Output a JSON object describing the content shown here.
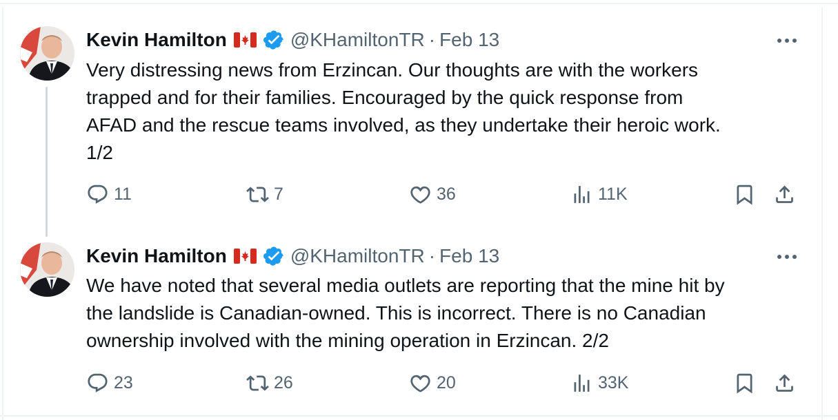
{
  "tweets": [
    {
      "author_name": "Kevin Hamilton",
      "handle": "@KHamiltonTR",
      "separator": "·",
      "date": "Feb 13",
      "text": "Very distressing news from Erzincan. Our thoughts are with the workers\ntrapped and for their families. Encouraged by the quick response from\nAFAD and the rescue teams involved, as they undertake their heroic work.\n1/2",
      "replies": "11",
      "reposts": "7",
      "likes": "36",
      "views": "11K"
    },
    {
      "author_name": "Kevin Hamilton",
      "handle": "@KHamiltonTR",
      "separator": "·",
      "date": "Feb 13",
      "text": "We have noted that several media outlets are reporting that the mine hit by\nthe landslide is Canadian-owned. This is incorrect. There is no Canadian\nownership involved with the mining operation in Erzincan. 2/2",
      "replies": "23",
      "reposts": "26",
      "likes": "20",
      "views": "33K"
    }
  ],
  "icons": {
    "flag": "canada-flag-icon",
    "verified": "verified-badge-icon",
    "more": "more-icon",
    "reply": "reply-icon",
    "repost": "repost-icon",
    "like": "like-icon",
    "views": "views-icon",
    "bookmark": "bookmark-icon",
    "share": "share-icon"
  },
  "colors": {
    "text": "#0f1419",
    "secondary": "#536471",
    "verified": "#1d9bf0",
    "thread_line": "#cfd9de",
    "flag_red": "#d52b1e"
  }
}
